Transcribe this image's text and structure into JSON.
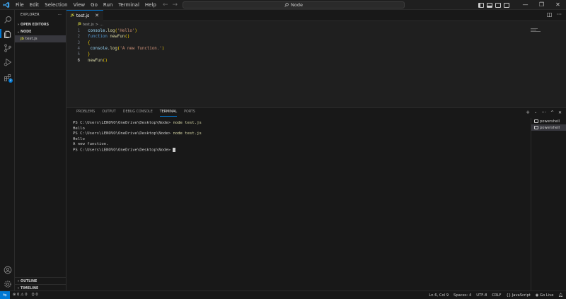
{
  "titlebar": {
    "menu": [
      "File",
      "Edit",
      "Selection",
      "View",
      "Go",
      "Run",
      "Terminal",
      "Help"
    ],
    "search_text": "Node"
  },
  "sidebar": {
    "title": "EXPLORER",
    "more": "···",
    "open_editors": "OPEN EDITORS",
    "folder": "NODE",
    "file": "test.js",
    "outline": "OUTLINE",
    "timeline": "TIMELINE"
  },
  "editor": {
    "tab_label": "test.js",
    "breadcrumb_file": "test.js",
    "breadcrumb_sep": ">",
    "breadcrumb_more": "...",
    "line_numbers": [
      "1",
      "2",
      "3",
      "4",
      "5",
      "6"
    ],
    "lines": [
      {
        "parts": [
          [
            "var",
            "console"
          ],
          [
            "",
            "."
          ],
          [
            "fn",
            "log"
          ],
          [
            "brace",
            "("
          ],
          [
            "str",
            "'Hello'"
          ],
          [
            "brace",
            ")"
          ]
        ]
      },
      {
        "parts": [
          [
            "kw",
            "function"
          ],
          [
            "",
            " "
          ],
          [
            "fn",
            "newFun"
          ],
          [
            "brace",
            "()"
          ]
        ]
      },
      {
        "parts": [
          [
            "brace",
            "{"
          ]
        ]
      },
      {
        "parts": [
          [
            "",
            " "
          ],
          [
            "var",
            "console"
          ],
          [
            "",
            "."
          ],
          [
            "fn",
            "log"
          ],
          [
            "brace",
            "("
          ],
          [
            "str",
            "'A new function.'"
          ],
          [
            "brace",
            ")"
          ]
        ]
      },
      {
        "parts": [
          [
            "brace",
            "}"
          ]
        ]
      },
      {
        "parts": [
          [
            "fn",
            "newFun"
          ],
          [
            "brace",
            "()"
          ]
        ]
      }
    ]
  },
  "panel": {
    "tabs": [
      "PROBLEMS",
      "OUTPUT",
      "DEBUG CONSOLE",
      "TERMINAL",
      "PORTS"
    ],
    "active_tab": "TERMINAL",
    "terminal_lines": [
      {
        "prompt": "PS C:\\Users\\LENOVO\\OneDrive\\Desktop\\Node> ",
        "cmd": "node test.js"
      },
      {
        "text": "Hello"
      },
      {
        "prompt": "PS C:\\Users\\LENOVO\\OneDrive\\Desktop\\Node> ",
        "cmd": "node test.js"
      },
      {
        "text": "Hello"
      },
      {
        "text": "A new function."
      },
      {
        "prompt": "PS C:\\Users\\LENOVO\\OneDrive\\Desktop\\Node> ",
        "cmd": "",
        "cursor": true
      }
    ],
    "terminals": [
      "powershell",
      "powershell"
    ]
  },
  "statusbar": {
    "errors": "0",
    "warnings": "0",
    "ports": "0",
    "position": "Ln 6, Col 9",
    "spaces": "Spaces: 4",
    "encoding": "UTF-8",
    "eol": "CRLF",
    "language": "JavaScript",
    "golive": "Go Live"
  },
  "colors": {
    "accent": "#0078d4",
    "js_icon": "#cbcb41"
  },
  "icons": {
    "activity": [
      "explorer-icon",
      "search-icon",
      "source-control-icon",
      "run-debug-icon",
      "extensions-icon"
    ],
    "bottom": [
      "account-icon",
      "settings-gear-icon"
    ],
    "extensions_badge": "2"
  }
}
